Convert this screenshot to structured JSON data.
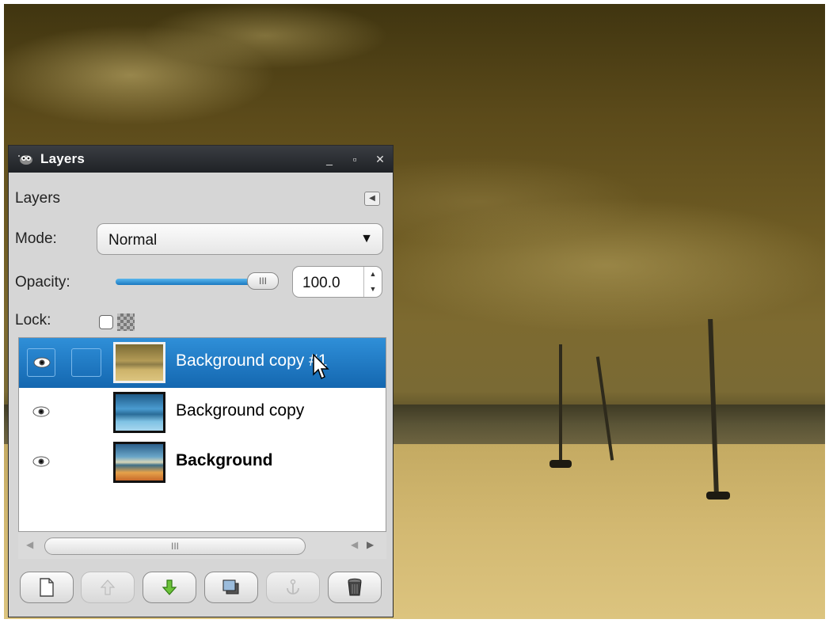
{
  "window": {
    "title": "Layers"
  },
  "panel": {
    "heading": "Layers",
    "mode_label": "Mode:",
    "mode_value": "Normal",
    "opacity_label": "Opacity:",
    "opacity_value": "100.0",
    "opacity_fraction": 1.0,
    "lock_label": "Lock:",
    "lock_checked": false
  },
  "layers": [
    {
      "name": "Background copy #1",
      "visible": true,
      "selected": true,
      "bold": false
    },
    {
      "name": "Background copy",
      "visible": true,
      "selected": false,
      "bold": false
    },
    {
      "name": "Background",
      "visible": true,
      "selected": false,
      "bold": true
    }
  ],
  "toolbar": {
    "buttons": [
      {
        "icon": "new-layer-icon",
        "enabled": true
      },
      {
        "icon": "raise-layer-icon",
        "enabled": false
      },
      {
        "icon": "lower-layer-icon",
        "enabled": true
      },
      {
        "icon": "duplicate-layer-icon",
        "enabled": true
      },
      {
        "icon": "anchor-layer-icon",
        "enabled": false
      },
      {
        "icon": "delete-layer-icon",
        "enabled": true
      }
    ]
  },
  "colors": {
    "selection": "#1a78c0",
    "photo_tone": "#c9ae66"
  }
}
